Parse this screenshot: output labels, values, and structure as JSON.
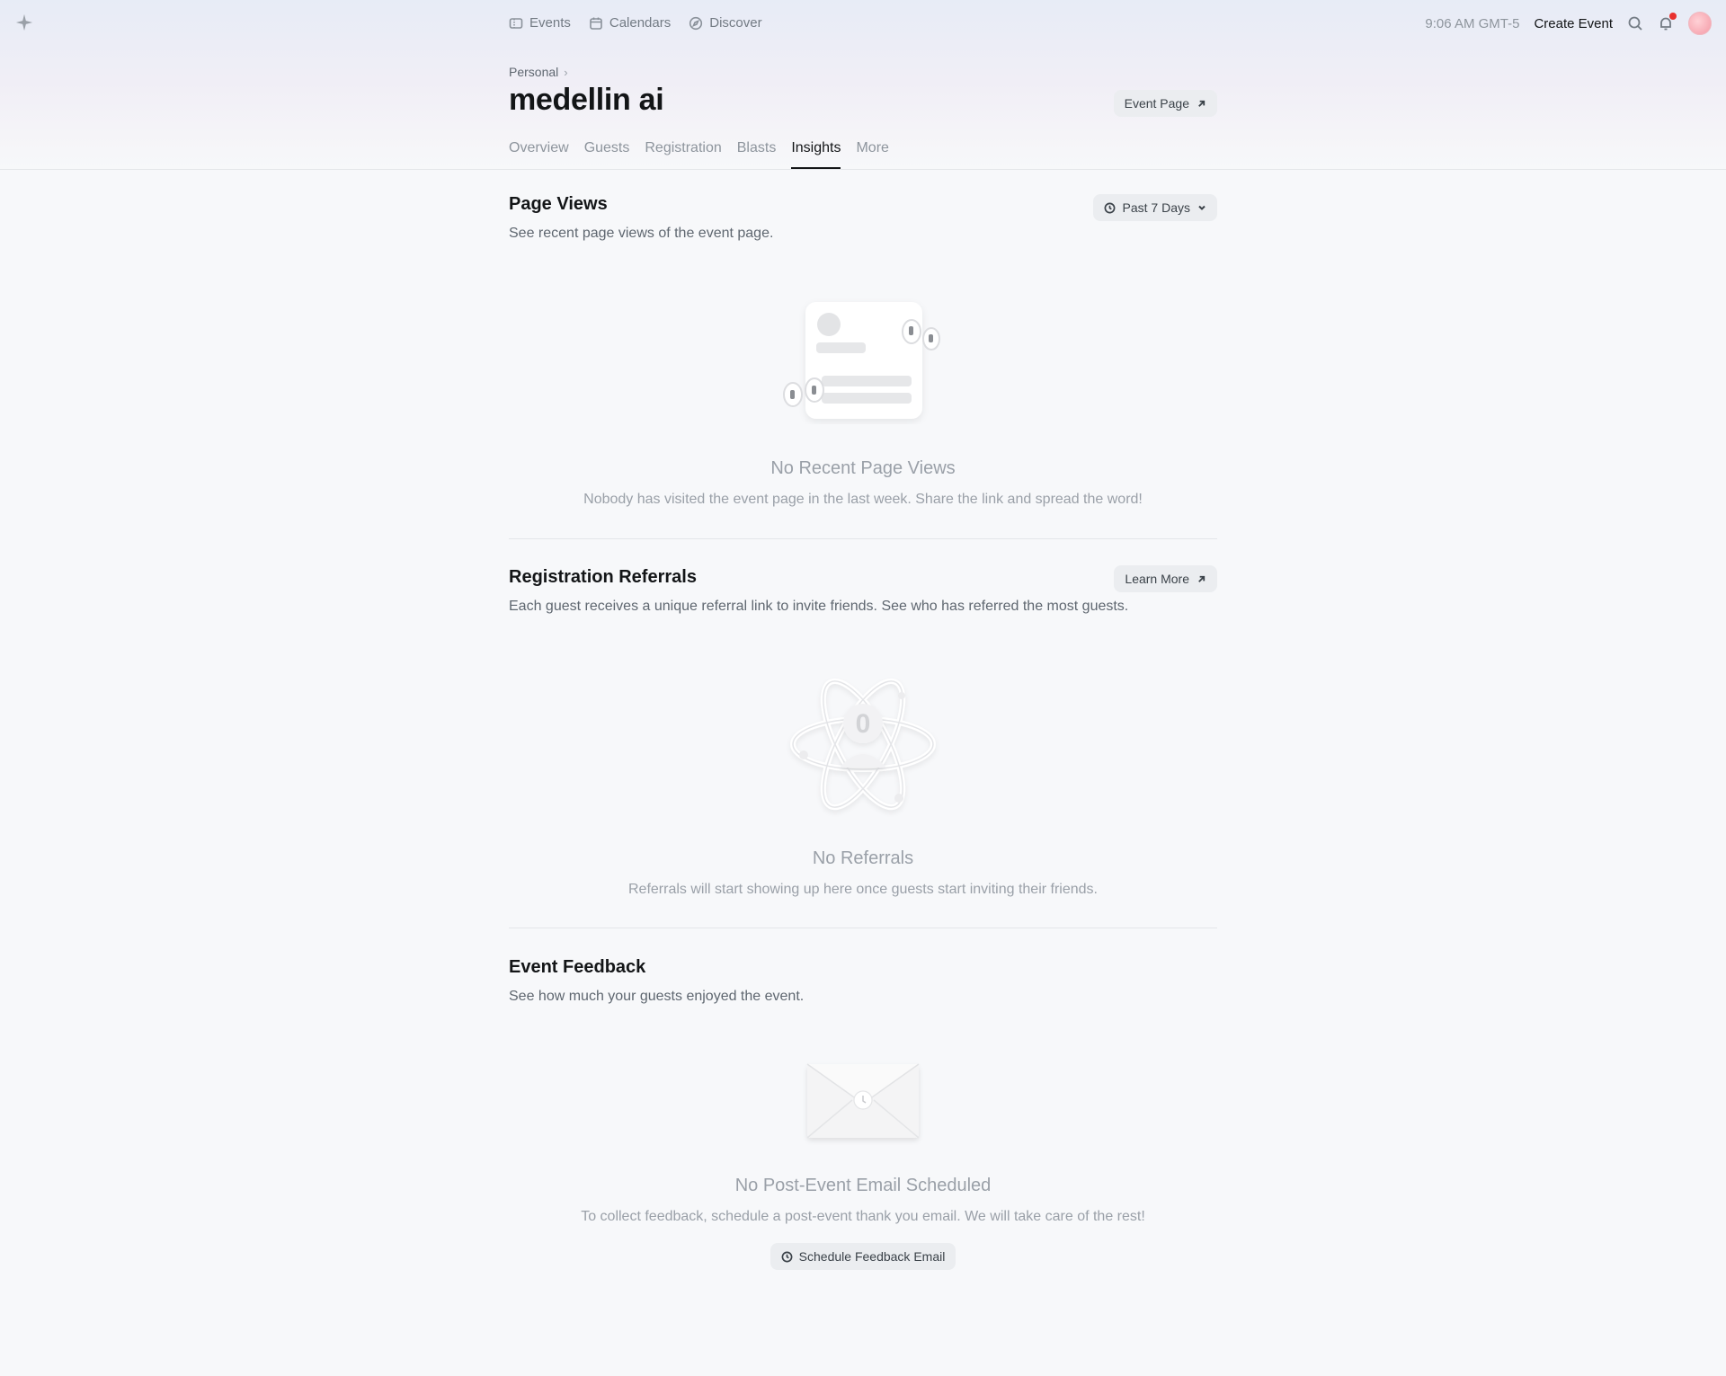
{
  "nav": {
    "links": [
      {
        "label": "Events",
        "icon": "ticket-icon"
      },
      {
        "label": "Calendars",
        "icon": "calendar-icon"
      },
      {
        "label": "Discover",
        "icon": "compass-icon"
      }
    ],
    "clock": "9:06 AM GMT-5",
    "create_event": "Create Event"
  },
  "header": {
    "breadcrumb": "Personal",
    "title": "medellin ai",
    "event_page_button": "Event Page"
  },
  "tabs": [
    {
      "label": "Overview",
      "active": false
    },
    {
      "label": "Guests",
      "active": false
    },
    {
      "label": "Registration",
      "active": false
    },
    {
      "label": "Blasts",
      "active": false
    },
    {
      "label": "Insights",
      "active": true
    },
    {
      "label": "More",
      "active": false
    }
  ],
  "page_views": {
    "title": "Page Views",
    "description": "See recent page views of the event page.",
    "range_button": "Past 7 Days",
    "empty_title": "No Recent Page Views",
    "empty_desc": "Nobody has visited the event page in the last week. Share the link and spread the word!"
  },
  "referrals": {
    "title": "Registration Referrals",
    "description": "Each guest receives a unique referral link to invite friends. See who has referred the most guests.",
    "learn_more_button": "Learn More",
    "counter": "0",
    "empty_title": "No Referrals",
    "empty_desc": "Referrals will start showing up here once guests start inviting their friends."
  },
  "feedback": {
    "title": "Event Feedback",
    "description": "See how much your guests enjoyed the event.",
    "empty_title": "No Post-Event Email Scheduled",
    "empty_desc": "To collect feedback, schedule a post-event thank you email. We will take care of the rest!",
    "schedule_button": "Schedule Feedback Email"
  },
  "colors": {
    "accent_text": "#131517",
    "muted_text": "#9aa0a8",
    "notification_dot": "#e8312f"
  }
}
